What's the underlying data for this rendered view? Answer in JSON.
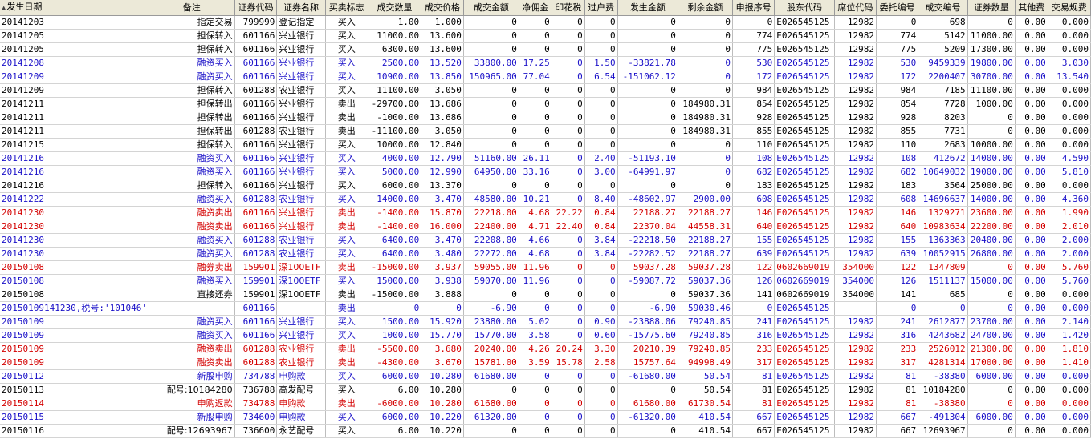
{
  "columns": [
    "发生日期",
    "备注",
    "证券代码",
    "证券名称",
    "买卖标志",
    "成交数量",
    "成交价格",
    "成交金额",
    "净佣金",
    "印花税",
    "过户费",
    "发生金额",
    "剩余金额",
    "申报序号",
    "股东代码",
    "席位代码",
    "委托编号",
    "成交编号",
    "证券数量",
    "其他费",
    "交易规费"
  ],
  "sort_indicator": "▲",
  "row_colors": {
    "black": "#000000",
    "blue": "#1a10c8",
    "red": "#d40000"
  },
  "rows": [
    {
      "color": "black",
      "cells": [
        "20141203",
        "指定交易",
        "799999",
        "登记指定",
        "买入",
        "1.00",
        "1.000",
        "0",
        "0",
        "0",
        "0",
        "0",
        "0",
        "0",
        "E026545125",
        "12982",
        "0",
        "698",
        "0",
        "0.00",
        "0.000"
      ]
    },
    {
      "color": "black",
      "cells": [
        "20141205",
        "担保转入",
        "601166",
        "兴业银行",
        "买入",
        "11000.00",
        "13.600",
        "0",
        "0",
        "0",
        "0",
        "0",
        "0",
        "774",
        "E026545125",
        "12982",
        "774",
        "5142",
        "11000.00",
        "0.00",
        "0.000"
      ]
    },
    {
      "color": "black",
      "cells": [
        "20141205",
        "担保转入",
        "601166",
        "兴业银行",
        "买入",
        "6300.00",
        "13.600",
        "0",
        "0",
        "0",
        "0",
        "0",
        "0",
        "775",
        "E026545125",
        "12982",
        "775",
        "5209",
        "17300.00",
        "0.00",
        "0.000"
      ]
    },
    {
      "color": "blue",
      "cells": [
        "20141208",
        "融资买入",
        "601166",
        "兴业银行",
        "买入",
        "2500.00",
        "13.520",
        "33800.00",
        "17.25",
        "0",
        "1.50",
        "-33821.78",
        "0",
        "530",
        "E026545125",
        "12982",
        "530",
        "9459339",
        "19800.00",
        "0.00",
        "3.030"
      ]
    },
    {
      "color": "blue",
      "cells": [
        "20141209",
        "融资买入",
        "601166",
        "兴业银行",
        "买入",
        "10900.00",
        "13.850",
        "150965.00",
        "77.04",
        "0",
        "6.54",
        "-151062.12",
        "0",
        "172",
        "E026545125",
        "12982",
        "172",
        "2200407",
        "30700.00",
        "0.00",
        "13.540"
      ]
    },
    {
      "color": "black",
      "cells": [
        "20141209",
        "担保转入",
        "601288",
        "农业银行",
        "买入",
        "11100.00",
        "3.050",
        "0",
        "0",
        "0",
        "0",
        "0",
        "0",
        "984",
        "E026545125",
        "12982",
        "984",
        "7185",
        "11100.00",
        "0.00",
        "0.000"
      ]
    },
    {
      "color": "black",
      "cells": [
        "20141211",
        "担保转出",
        "601166",
        "兴业银行",
        "卖出",
        "-29700.00",
        "13.686",
        "0",
        "0",
        "0",
        "0",
        "0",
        "184980.31",
        "854",
        "E026545125",
        "12982",
        "854",
        "7728",
        "1000.00",
        "0.00",
        "0.000"
      ]
    },
    {
      "color": "black",
      "cells": [
        "20141211",
        "担保转出",
        "601166",
        "兴业银行",
        "卖出",
        "-1000.00",
        "13.686",
        "0",
        "0",
        "0",
        "0",
        "0",
        "184980.31",
        "928",
        "E026545125",
        "12982",
        "928",
        "8203",
        "0",
        "0.00",
        "0.000"
      ]
    },
    {
      "color": "black",
      "cells": [
        "20141211",
        "担保转出",
        "601288",
        "农业银行",
        "卖出",
        "-11100.00",
        "3.050",
        "0",
        "0",
        "0",
        "0",
        "0",
        "184980.31",
        "855",
        "E026545125",
        "12982",
        "855",
        "7731",
        "0",
        "0.00",
        "0.000"
      ]
    },
    {
      "color": "black",
      "cells": [
        "20141215",
        "担保转入",
        "601166",
        "兴业银行",
        "买入",
        "10000.00",
        "12.840",
        "0",
        "0",
        "0",
        "0",
        "0",
        "0",
        "110",
        "E026545125",
        "12982",
        "110",
        "2683",
        "10000.00",
        "0.00",
        "0.000"
      ]
    },
    {
      "color": "blue",
      "cells": [
        "20141216",
        "融资买入",
        "601166",
        "兴业银行",
        "买入",
        "4000.00",
        "12.790",
        "51160.00",
        "26.11",
        "0",
        "2.40",
        "-51193.10",
        "0",
        "108",
        "E026545125",
        "12982",
        "108",
        "412672",
        "14000.00",
        "0.00",
        "4.590"
      ]
    },
    {
      "color": "blue",
      "cells": [
        "20141216",
        "融资买入",
        "601166",
        "兴业银行",
        "买入",
        "5000.00",
        "12.990",
        "64950.00",
        "33.16",
        "0",
        "3.00",
        "-64991.97",
        "0",
        "682",
        "E026545125",
        "12982",
        "682",
        "10649032",
        "19000.00",
        "0.00",
        "5.810"
      ]
    },
    {
      "color": "black",
      "cells": [
        "20141216",
        "担保转入",
        "601166",
        "兴业银行",
        "买入",
        "6000.00",
        "13.370",
        "0",
        "0",
        "0",
        "0",
        "0",
        "0",
        "183",
        "E026545125",
        "12982",
        "183",
        "3564",
        "25000.00",
        "0.00",
        "0.000"
      ]
    },
    {
      "color": "blue",
      "cells": [
        "20141222",
        "融资买入",
        "601288",
        "农业银行",
        "买入",
        "14000.00",
        "3.470",
        "48580.00",
        "10.21",
        "0",
        "8.40",
        "-48602.97",
        "2900.00",
        "608",
        "E026545125",
        "12982",
        "608",
        "14696637",
        "14000.00",
        "0.00",
        "4.360"
      ]
    },
    {
      "color": "red",
      "cells": [
        "20141230",
        "融资卖出",
        "601166",
        "兴业银行",
        "卖出",
        "-1400.00",
        "15.870",
        "22218.00",
        "4.68",
        "22.22",
        "0.84",
        "22188.27",
        "22188.27",
        "146",
        "E026545125",
        "12982",
        "146",
        "1329271",
        "23600.00",
        "0.00",
        "1.990"
      ]
    },
    {
      "color": "red",
      "cells": [
        "20141230",
        "融资卖出",
        "601166",
        "兴业银行",
        "卖出",
        "-1400.00",
        "16.000",
        "22400.00",
        "4.71",
        "22.40",
        "0.84",
        "22370.04",
        "44558.31",
        "640",
        "E026545125",
        "12982",
        "640",
        "10983634",
        "22200.00",
        "0.00",
        "2.010"
      ]
    },
    {
      "color": "blue",
      "cells": [
        "20141230",
        "融资买入",
        "601288",
        "农业银行",
        "买入",
        "6400.00",
        "3.470",
        "22208.00",
        "4.66",
        "0",
        "3.84",
        "-22218.50",
        "22188.27",
        "155",
        "E026545125",
        "12982",
        "155",
        "1363363",
        "20400.00",
        "0.00",
        "2.000"
      ]
    },
    {
      "color": "blue",
      "cells": [
        "20141230",
        "融资买入",
        "601288",
        "农业银行",
        "买入",
        "6400.00",
        "3.480",
        "22272.00",
        "4.68",
        "0",
        "3.84",
        "-22282.52",
        "22188.27",
        "639",
        "E026545125",
        "12982",
        "639",
        "10052915",
        "26800.00",
        "0.00",
        "2.000"
      ]
    },
    {
      "color": "red",
      "cells": [
        "20150108",
        "融券卖出",
        "159901",
        "深100ETF",
        "卖出",
        "-15000.00",
        "3.937",
        "59055.00",
        "11.96",
        "0",
        "0",
        "59037.28",
        "59037.28",
        "122",
        "0602669019",
        "354000",
        "122",
        "1347809",
        "0",
        "0.00",
        "5.760"
      ]
    },
    {
      "color": "blue",
      "cells": [
        "20150108",
        "融资买入",
        "159901",
        "深100ETF",
        "买入",
        "15000.00",
        "3.938",
        "59070.00",
        "11.96",
        "0",
        "0",
        "-59087.72",
        "59037.36",
        "126",
        "0602669019",
        "354000",
        "126",
        "1511137",
        "15000.00",
        "0.00",
        "5.760"
      ]
    },
    {
      "color": "black",
      "cells": [
        "20150108",
        "直接还券",
        "159901",
        "深100ETF",
        "卖出",
        "-15000.00",
        "3.888",
        "0",
        "0",
        "0",
        "0",
        "0",
        "59037.36",
        "141",
        "0602669019",
        "354000",
        "141",
        "685",
        "0",
        "0.00",
        "0.000"
      ]
    },
    {
      "color": "blue",
      "cells": [
        "20150109141230,税号:'101046'",
        "",
        "601166",
        "",
        "卖出",
        "0",
        "0",
        "-6.90",
        "0",
        "0",
        "0",
        "-6.90",
        "59030.46",
        "0",
        "E026545125",
        "",
        "0",
        "0",
        "0",
        "0.00",
        "0.000"
      ]
    },
    {
      "color": "blue",
      "cells": [
        "20150109",
        "融资买入",
        "601166",
        "兴业银行",
        "买入",
        "1500.00",
        "15.920",
        "23880.00",
        "5.02",
        "0",
        "0.90",
        "-23888.06",
        "79240.85",
        "241",
        "E026545125",
        "12982",
        "241",
        "2612877",
        "23700.00",
        "0.00",
        "2.140"
      ]
    },
    {
      "color": "blue",
      "cells": [
        "20150109",
        "融资买入",
        "601166",
        "兴业银行",
        "买入",
        "1000.00",
        "15.770",
        "15770.00",
        "3.58",
        "0",
        "0.60",
        "-15775.60",
        "79240.85",
        "316",
        "E026545125",
        "12982",
        "316",
        "4243682",
        "24700.00",
        "0.00",
        "1.420"
      ]
    },
    {
      "color": "red",
      "cells": [
        "20150109",
        "融资卖出",
        "601288",
        "农业银行",
        "卖出",
        "-5500.00",
        "3.680",
        "20240.00",
        "4.26",
        "20.24",
        "3.30",
        "20210.39",
        "79240.85",
        "233",
        "E026545125",
        "12982",
        "233",
        "2526012",
        "21300.00",
        "0.00",
        "1.810"
      ]
    },
    {
      "color": "red",
      "cells": [
        "20150109",
        "融资卖出",
        "601288",
        "农业银行",
        "卖出",
        "-4300.00",
        "3.670",
        "15781.00",
        "3.59",
        "15.78",
        "2.58",
        "15757.64",
        "94998.49",
        "317",
        "E026545125",
        "12982",
        "317",
        "4281314",
        "17000.00",
        "0.00",
        "1.410"
      ]
    },
    {
      "color": "blue",
      "cells": [
        "20150112",
        "新股申购",
        "734788",
        "申购款",
        "买入",
        "6000.00",
        "10.280",
        "61680.00",
        "0",
        "0",
        "0",
        "-61680.00",
        "50.54",
        "81",
        "E026545125",
        "12982",
        "81",
        "-38380",
        "6000.00",
        "0.00",
        "0.000"
      ]
    },
    {
      "color": "black",
      "cells": [
        "20150113",
        "配号:10184280",
        "736788",
        "高发配号",
        "买入",
        "6.00",
        "10.280",
        "0",
        "0",
        "0",
        "0",
        "0",
        "50.54",
        "81",
        "E026545125",
        "12982",
        "81",
        "10184280",
        "0",
        "0.00",
        "0.000"
      ]
    },
    {
      "color": "red",
      "cells": [
        "20150114",
        "申购返款",
        "734788",
        "申购款",
        "卖出",
        "-6000.00",
        "10.280",
        "61680.00",
        "0",
        "0",
        "0",
        "61680.00",
        "61730.54",
        "81",
        "E026545125",
        "12982",
        "81",
        "-38380",
        "0",
        "0.00",
        "0.000"
      ]
    },
    {
      "color": "blue",
      "cells": [
        "20150115",
        "新股申购",
        "734600",
        "申购款",
        "买入",
        "6000.00",
        "10.220",
        "61320.00",
        "0",
        "0",
        "0",
        "-61320.00",
        "410.54",
        "667",
        "E026545125",
        "12982",
        "667",
        "-491304",
        "6000.00",
        "0.00",
        "0.000"
      ]
    },
    {
      "color": "black",
      "cells": [
        "20150116",
        "配号:12693967",
        "736600",
        "永艺配号",
        "买入",
        "6.00",
        "10.220",
        "0",
        "0",
        "0",
        "0",
        "0",
        "410.54",
        "667",
        "E026545125",
        "12982",
        "667",
        "12693967",
        "0",
        "0.00",
        "0.000"
      ]
    }
  ]
}
